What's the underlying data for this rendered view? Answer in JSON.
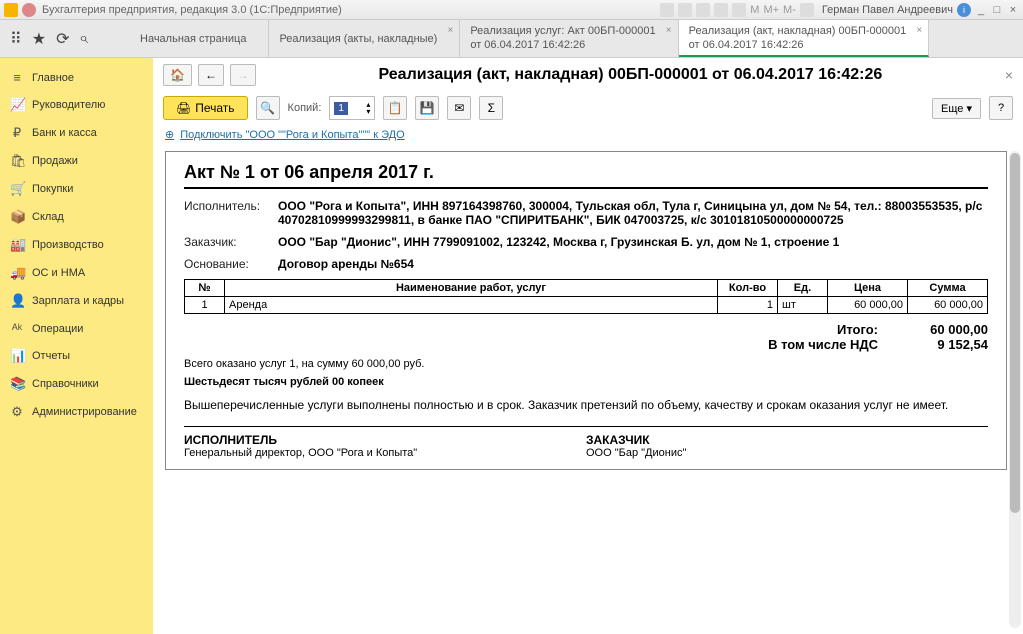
{
  "titlebar": {
    "title": "Бухгалтерия предприятия, редакция 3.0  (1С:Предприятие)",
    "user": "Герман Павел Андреевич"
  },
  "tabs": {
    "start": "Начальная страница",
    "t1": "Реализация (акты, накладные)",
    "t2a": "Реализация услуг: Акт 00БП-000001",
    "t2b": "от 06.04.2017 16:42:26",
    "t3a": "Реализация (акт, накладная) 00БП-000001",
    "t3b": "от 06.04.2017 16:42:26"
  },
  "sidebar": [
    {
      "icon": "≡",
      "label": "Главное"
    },
    {
      "icon": "📈",
      "label": "Руководителю"
    },
    {
      "icon": "₽",
      "label": "Банк и касса"
    },
    {
      "icon": "🛍",
      "label": "Продажи"
    },
    {
      "icon": "🛒",
      "label": "Покупки"
    },
    {
      "icon": "📦",
      "label": "Склад"
    },
    {
      "icon": "🏭",
      "label": "Производство"
    },
    {
      "icon": "🚚",
      "label": "ОС и НМА"
    },
    {
      "icon": "👤",
      "label": "Зарплата и кадры"
    },
    {
      "icon": "ᴬᵏ",
      "label": "Операции"
    },
    {
      "icon": "📊",
      "label": "Отчеты"
    },
    {
      "icon": "📚",
      "label": "Справочники"
    },
    {
      "icon": "⚙",
      "label": "Администрирование"
    }
  ],
  "header": {
    "title": "Реализация (акт, накладная) 00БП-000001 от 06.04.2017 16:42:26"
  },
  "toolbar": {
    "print": "Печать",
    "copies": "Копий:",
    "copies_val": "1",
    "more": "Еще"
  },
  "edo_link": "Подключить \"ООО \"\"Рога и Копыта\"\"\" к ЭДО",
  "doc": {
    "title": "Акт № 1 от 06 апреля 2017 г.",
    "executor_lbl": "Исполнитель:",
    "executor": "ООО \"Рога и Копыта\", ИНН 897164398760, 300004, Тульская обл, Тула г, Синицына ул, дом № 54, тел.: 88003553535, р/с 40702810999993299811, в банке ПАО \"СПИРИТБАНК\", БИК 047003725, к/с 30101810500000000725",
    "customer_lbl": "Заказчик:",
    "customer": "ООО \"Бар \"Дионис\", ИНН 7799091002, 123242, Москва г, Грузинская Б. ул, дом № 1, строение 1",
    "basis_lbl": "Основание:",
    "basis": "Договор аренды №654",
    "cols": {
      "n": "№",
      "name": "Наименование работ, услуг",
      "qty": "Кол-во",
      "unit": "Ед.",
      "price": "Цена",
      "sum": "Сумма"
    },
    "row": {
      "n": "1",
      "name": "Аренда",
      "qty": "1",
      "unit": "шт",
      "price": "60 000,00",
      "sum": "60 000,00"
    },
    "total_lbl": "Итого:",
    "total": "60 000,00",
    "vat_lbl": "В том числе НДС",
    "vat": "9 152,54",
    "summary": "Всего оказано услуг 1, на сумму 60 000,00 руб.",
    "words": "Шестьдесят тысяч рублей 00 копеек",
    "legal": "Вышеперечисленные услуги выполнены полностью и в срок. Заказчик претензий по объему, качеству и срокам оказания услуг не имеет.",
    "exec_t": "ИСПОЛНИТЕЛЬ",
    "exec_s": "Генеральный директор, ООО \"Рога и Копыта\"",
    "cust_t": "ЗАКАЗЧИК",
    "cust_s": "ООО \"Бар \"Дионис\""
  }
}
